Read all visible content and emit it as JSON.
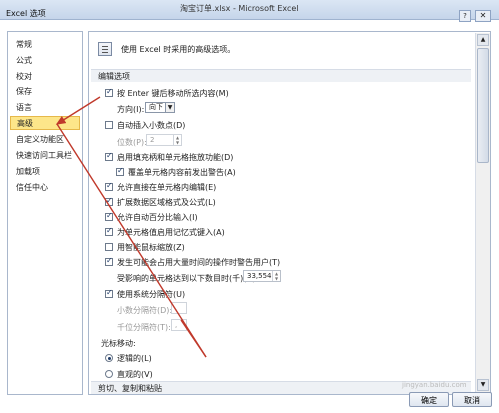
{
  "window": {
    "doc_title": "淘宝订单.xlsx - Microsoft Excel",
    "dialog_title": "Excel 选项",
    "help": "?",
    "close": "✕"
  },
  "sidebar": {
    "items": [
      "常规",
      "公式",
      "校对",
      "保存",
      "语言",
      "高级",
      "自定义功能区",
      "快速访问工具栏",
      "加载项",
      "信任中心"
    ],
    "selected": "高级"
  },
  "content": {
    "intro": "使用 Excel 时采用的高级选项。",
    "section_edit": "编辑选项",
    "opt_enter_move": "按 Enter 键后移动所选内容(M)",
    "direction_label": "方向(I):",
    "direction_value": "向下",
    "opt_auto_decimal": "自动插入小数点(D)",
    "places_label": "位数(P):",
    "places_value": "2",
    "opt_fill_handle": "启用填充柄和单元格拖放功能(D)",
    "opt_overwrite_alert": "覆盖单元格内容前发出警告(A)",
    "opt_edit_in_cell": "允许直接在单元格内编辑(E)",
    "opt_extend_formats": "扩展数据区域格式及公式(L)",
    "opt_auto_percent": "允许自动百分比输入(I)",
    "opt_autocomplete": "为单元格值启用记忆式键入(A)",
    "opt_zoom_roll": "用智能鼠标缩放(Z)",
    "opt_time_alert": "发生可能会占用大量时间的操作时警告用户(T)",
    "cells_label": "受影响的单元格达到以下数目时(千)(U):",
    "cells_value": "33,554",
    "opt_system_sep": "使用系统分隔符(U)",
    "decimal_sep_label": "小数分隔符(D):",
    "decimal_sep_value": ".",
    "thousands_sep_label": "千位分隔符(T):",
    "thousands_sep_value": ",",
    "cursor_label": "光标移动:",
    "radio_logical": "逻辑的(L)",
    "radio_visual": "直观的(V)",
    "section_clip": "剪切、复制和粘贴"
  },
  "buttons": {
    "ok": "确定",
    "cancel": "取消"
  },
  "watermark": "jingyan.baidu.com",
  "colors": {
    "selected_bg": "#fde68a",
    "arrow": "#c0392b"
  }
}
